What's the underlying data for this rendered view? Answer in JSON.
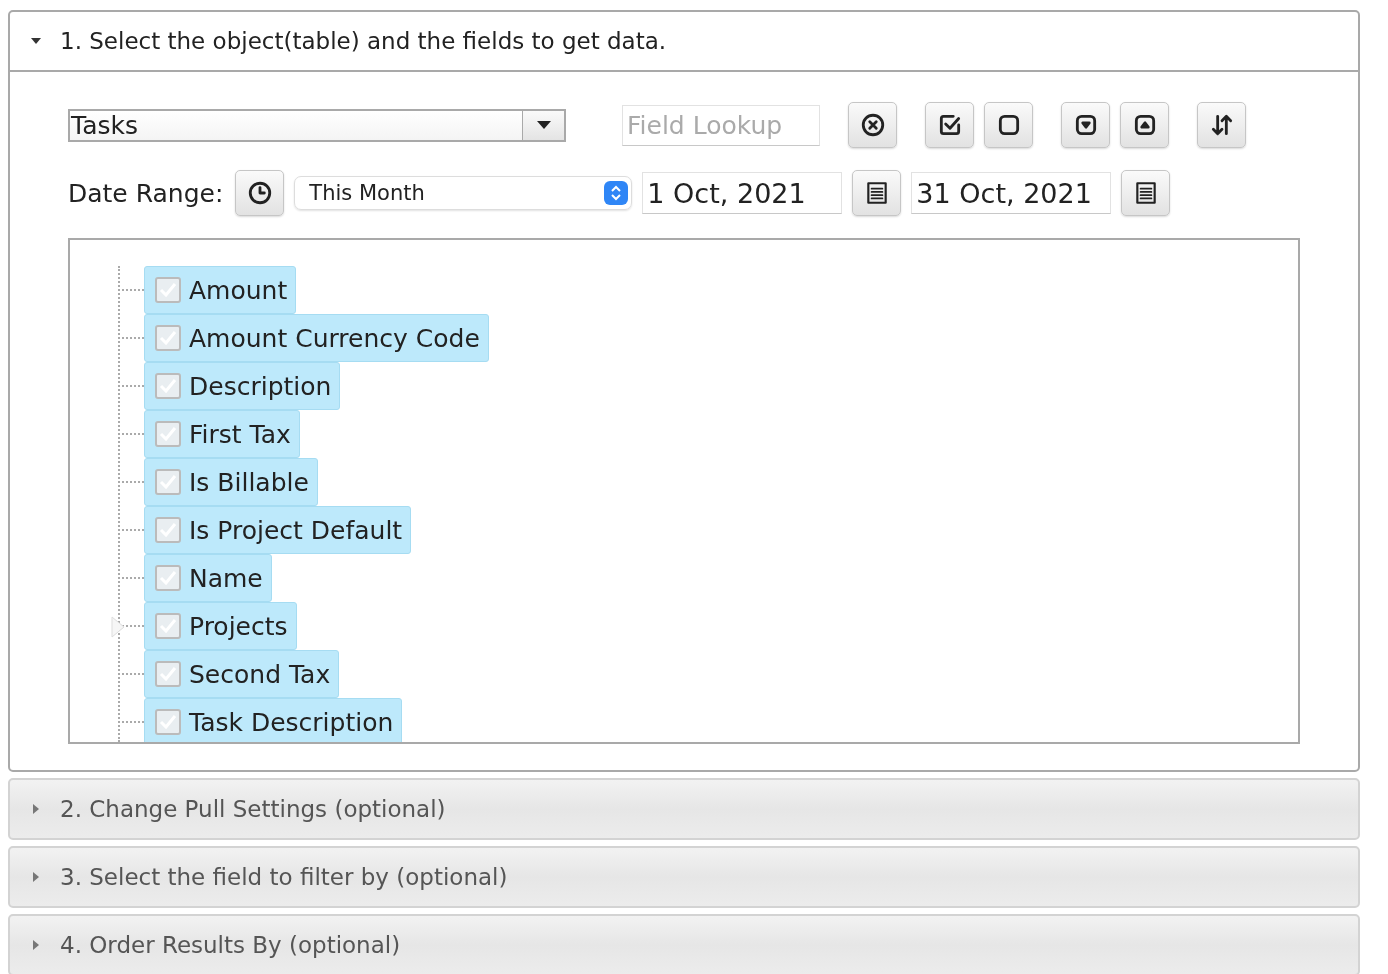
{
  "sections": [
    {
      "title": "1. Select the object(table) and the fields to get data.",
      "expanded": true
    },
    {
      "title": "2. Change Pull Settings (optional)",
      "expanded": false
    },
    {
      "title": "3. Select the field to filter by (optional)",
      "expanded": false
    },
    {
      "title": "4. Order Results By (optional)",
      "expanded": false
    }
  ],
  "object_select": {
    "value": "Tasks"
  },
  "field_lookup": {
    "placeholder": "Field Lookup"
  },
  "date_range": {
    "label": "Date Range:",
    "preset": "This Month",
    "start": "1 Oct, 2021",
    "end": "31 Oct, 2021"
  },
  "fields": [
    {
      "label": "Amount",
      "checked": true,
      "selected": true,
      "expandable": false
    },
    {
      "label": "Amount Currency Code",
      "checked": true,
      "selected": true,
      "expandable": false
    },
    {
      "label": "Description",
      "checked": true,
      "selected": true,
      "expandable": false
    },
    {
      "label": "First Tax",
      "checked": true,
      "selected": true,
      "expandable": false
    },
    {
      "label": "Is Billable",
      "checked": true,
      "selected": true,
      "expandable": false
    },
    {
      "label": "Is Project Default",
      "checked": true,
      "selected": true,
      "expandable": false
    },
    {
      "label": "Name",
      "checked": true,
      "selected": true,
      "expandable": false
    },
    {
      "label": "Projects",
      "checked": true,
      "selected": true,
      "expandable": true
    },
    {
      "label": "Second Tax",
      "checked": true,
      "selected": true,
      "expandable": false
    },
    {
      "label": "Task Description",
      "checked": true,
      "selected": true,
      "expandable": false
    }
  ]
}
